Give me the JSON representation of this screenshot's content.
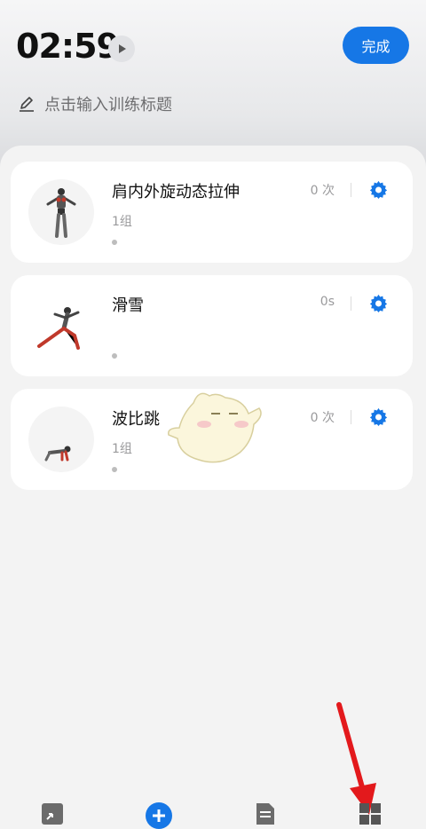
{
  "header": {
    "timer": "02:59",
    "done_label": "完成",
    "title_placeholder": "点击输入训练标题"
  },
  "exercises": [
    {
      "name": "肩内外旋动态拉伸",
      "sets": "1组",
      "count": "0 次",
      "thumb_icon": "shoulder-stretch-figure"
    },
    {
      "name": "滑雪",
      "sets": "",
      "count": "0s",
      "thumb_icon": "skiing-figure"
    },
    {
      "name": "波比跳",
      "sets": "1组",
      "count": "0 次",
      "thumb_icon": "burpee-figure"
    }
  ],
  "bottom_nav": {
    "icons": [
      "collapse-icon",
      "add-icon",
      "document-icon",
      "grid-icon"
    ]
  },
  "colors": {
    "accent": "#1677e6",
    "arrow": "#e3191c"
  }
}
